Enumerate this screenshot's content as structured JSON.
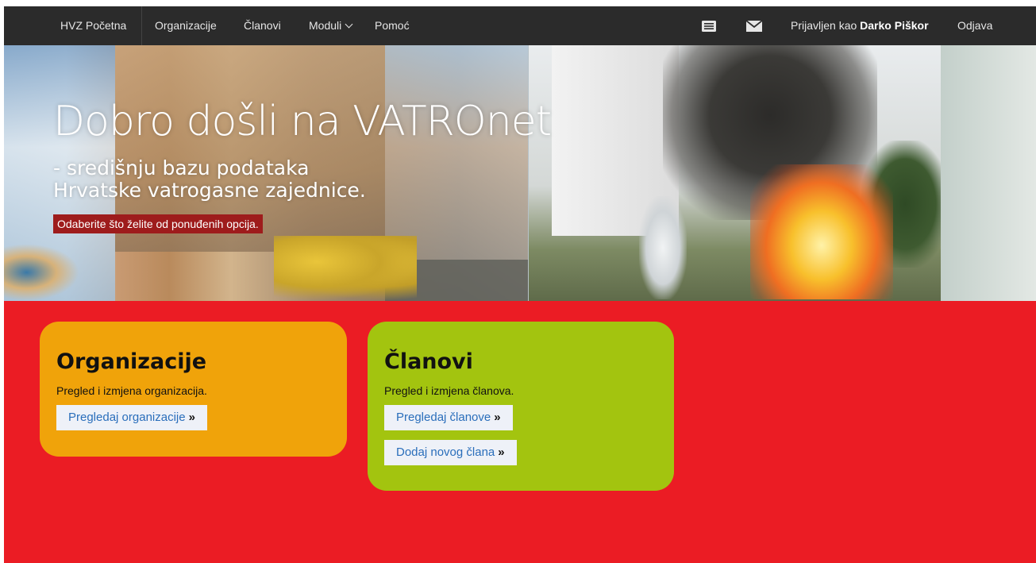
{
  "nav": {
    "home": "HVZ Početna",
    "organizations": "Organizacije",
    "members": "Članovi",
    "modules": "Moduli",
    "help": "Pomoć",
    "logged_in_prefix": "Prijavljen kao",
    "username": "Darko Piškor",
    "logout": "Odjava",
    "icons": [
      "news-icon",
      "mail-icon"
    ]
  },
  "hero": {
    "title": "Dobro došli na VATROnet",
    "subtitle_line1": "- središnju bazu podataka",
    "subtitle_line2": "Hrvatske vatrogasne zajednice.",
    "note": "Odaberite što želite od ponuđenih opcija."
  },
  "cards": {
    "organizations": {
      "title": "Organizacije",
      "description": "Pregled i izmjena organizacija.",
      "button": "Pregledaj organizacije"
    },
    "members": {
      "title": "Članovi",
      "description": "Pregled i izmjena članova.",
      "button_view": "Pregledaj članove",
      "button_add": "Dodaj novog člana"
    }
  },
  "symbols": {
    "raquo": "»"
  },
  "colors": {
    "nav_bg": "#2b2b2b",
    "main_bg": "#eb1c24",
    "org_card": "#f0a30a",
    "members_card": "#a3c40f",
    "note_bg": "#9e1c1c",
    "button_bg": "#eef1f8",
    "link": "#2a6ebb"
  }
}
